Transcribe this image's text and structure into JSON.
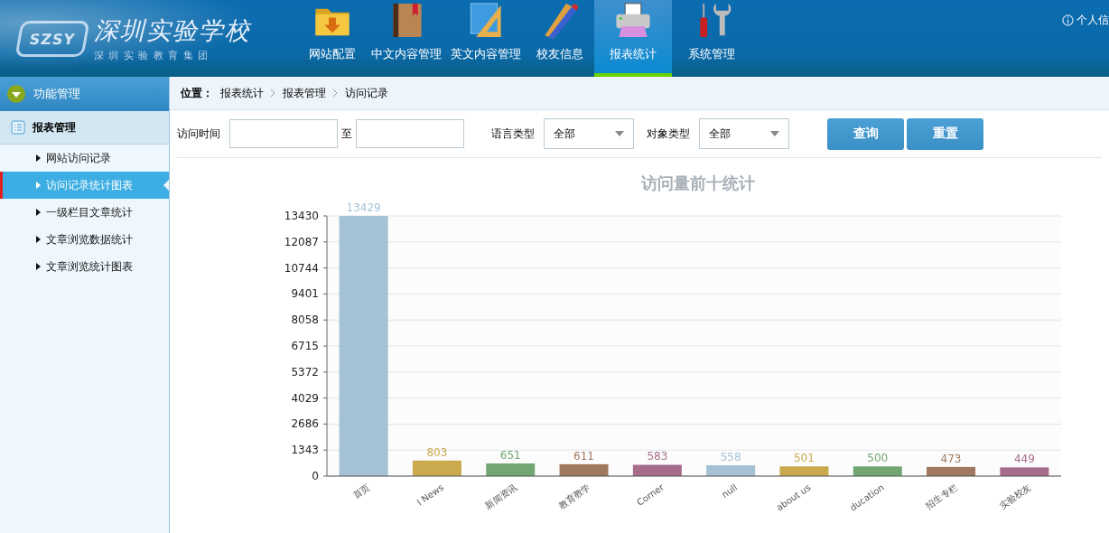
{
  "logo": {
    "mark": "SZSY",
    "title": "深圳实验学校",
    "subtitle": "深 圳 实 验 教 育 集 团"
  },
  "nav": [
    {
      "label": "网站配置",
      "selected": false
    },
    {
      "label": "中文内容管理",
      "selected": false
    },
    {
      "label": "英文内容管理",
      "selected": false
    },
    {
      "label": "校友信息",
      "selected": false
    },
    {
      "label": "报表统计",
      "selected": true
    },
    {
      "label": "系统管理",
      "selected": false
    }
  ],
  "user_link": "个人信",
  "sidebar": {
    "title": "功能管理",
    "section": "报表管理",
    "items": [
      {
        "label": "网站访问记录",
        "selected": false
      },
      {
        "label": "访问记录统计图表",
        "selected": true
      },
      {
        "label": "一级栏目文章统计",
        "selected": false
      },
      {
        "label": "文章浏览数据统计",
        "selected": false
      },
      {
        "label": "文章浏览统计图表",
        "selected": false
      }
    ]
  },
  "breadcrumb": {
    "label": "位置：",
    "items": [
      "报表统计",
      "报表管理",
      "访问记录"
    ]
  },
  "filters": {
    "time_label": "访问时间",
    "to_label": "至",
    "language_label": "语言类型",
    "language_value": "全部",
    "object_label": "对象类型",
    "object_value": "全部",
    "buttons": [
      "查询",
      "重置"
    ]
  },
  "chart": {
    "chart_data": {
      "type": "bar",
      "title": "访问量前十统计",
      "categories": [
        "首页",
        "l News",
        "新闻资讯",
        "教育教学",
        "Corner",
        "null",
        "about us",
        "ducation",
        "招生专栏",
        "实验校友"
      ],
      "values": [
        13429,
        803,
        651,
        611,
        583,
        558,
        501,
        500,
        473,
        449
      ],
      "ylim": [
        0,
        13430
      ],
      "yticks": [
        0,
        1343,
        2686,
        4029,
        5372,
        6715,
        8058,
        9401,
        10744,
        12087,
        13430
      ],
      "data_labels": true,
      "grid": true
    }
  }
}
